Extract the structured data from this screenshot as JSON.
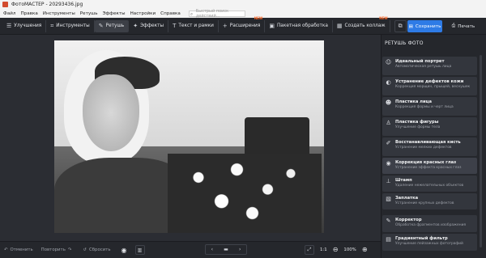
{
  "window": {
    "title": "ФотоМАСТЕР - 20293436.jpg"
  },
  "menu": [
    "Файл",
    "Правка",
    "Инструменты",
    "Ретушь",
    "Эффекты",
    "Настройки",
    "Справка"
  ],
  "search": {
    "placeholder": "Быстрый поиск действий..."
  },
  "toolbar": {
    "tabs": [
      {
        "label": "Улучшения",
        "icon": "sliders-icon"
      },
      {
        "label": "Инструменты",
        "icon": "crop-icon"
      },
      {
        "label": "Ретушь",
        "icon": "brush-icon"
      },
      {
        "label": "Эффекты",
        "icon": "effects-icon"
      },
      {
        "label": "Текст и рамки",
        "icon": "text-icon"
      },
      {
        "label": "Расширения",
        "icon": "plus-icon",
        "badge": "NEW"
      },
      {
        "label": "Пакетная обработка",
        "icon": "batch-icon"
      },
      {
        "label": "Создать коллаж",
        "icon": "collage-icon",
        "badge": "NEW"
      }
    ],
    "save_label": "Сохранить",
    "print_label": "Печать"
  },
  "bottombar": {
    "undo_label": "Отменить",
    "redo_label": "Повторить",
    "reset_label": "Сбросить",
    "scale_label": "1:1",
    "zoom": "100%"
  },
  "retouch_panel": {
    "title": "РЕТУШЬ ФОТО",
    "items": [
      {
        "name": "Идеальный портрет",
        "desc": "Автоматическая ретушь лица",
        "icon": "portrait-icon"
      },
      {
        "name": "Устранение дефектов кожи",
        "desc": "Коррекция морщин, прыщей, веснушек",
        "icon": "skin-icon"
      },
      {
        "name": "Пластика лица",
        "desc": "Коррекция формы и черт лица",
        "icon": "face-icon"
      },
      {
        "name": "Пластика фигуры",
        "desc": "Улучшение формы тела",
        "icon": "figure-icon"
      },
      {
        "name": "Восстанавливающая кисть",
        "desc": "Устранение мелких дефектов",
        "icon": "heal-brush-icon"
      },
      {
        "name": "Коррекция красных глаз",
        "desc": "Устранение эффекта красных глаз",
        "icon": "eye-icon"
      },
      {
        "name": "Штамп",
        "desc": "Удаление нежелательных объектов",
        "icon": "stamp-icon"
      },
      {
        "name": "Заплатка",
        "desc": "Устранение крупных дефектов",
        "icon": "patch-icon"
      },
      {
        "name": "Корректор",
        "desc": "Обработка фрагментов изображения",
        "icon": "corrector-icon"
      },
      {
        "name": "Градиентный фильтр",
        "desc": "Улучшение пейзажных фотографий",
        "icon": "gradient-icon"
      }
    ]
  }
}
